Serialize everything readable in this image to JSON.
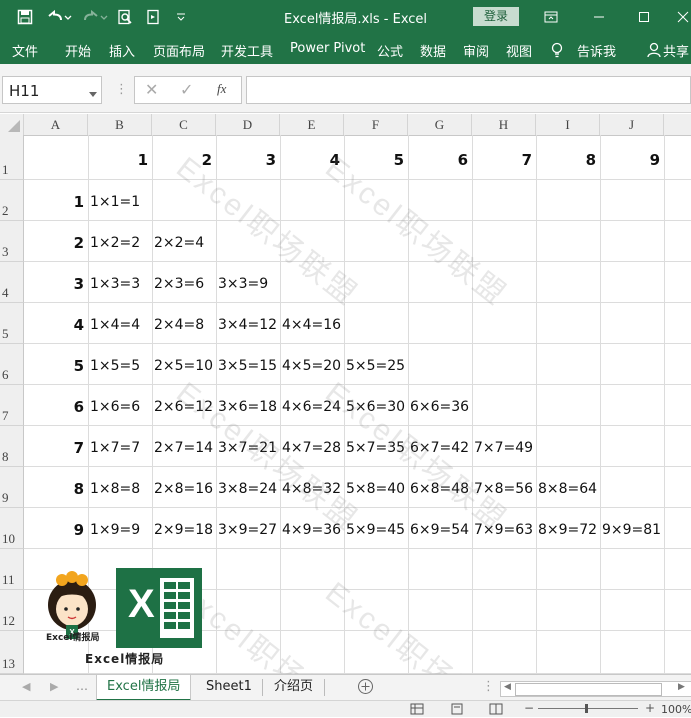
{
  "titlebar": {
    "doc_title": "Excel情报局.xls  -  Excel",
    "login_label": "登录"
  },
  "ribbon": {
    "tabs": [
      "文件",
      "开始",
      "插入",
      "页面布局",
      "开发工具",
      "Power Pivot",
      "公式",
      "数据",
      "审阅",
      "视图"
    ],
    "tell_me": "告诉我",
    "share": "共享"
  },
  "formula_bar": {
    "name_box": "H11",
    "cancel": "✕",
    "confirm": "✓",
    "fx": "fx",
    "value": ""
  },
  "columns": [
    "A",
    "B",
    "C",
    "D",
    "E",
    "F",
    "G",
    "H",
    "I",
    "J"
  ],
  "rows": [
    "1",
    "2",
    "3",
    "4",
    "5",
    "6",
    "7",
    "8",
    "9",
    "10",
    "11",
    "12",
    "13"
  ],
  "table": {
    "top_header": [
      "1",
      "2",
      "3",
      "4",
      "5",
      "6",
      "7",
      "8",
      "9"
    ],
    "left_header": [
      "1",
      "2",
      "3",
      "4",
      "5",
      "6",
      "7",
      "8",
      "9"
    ],
    "cells": [
      [
        "1×1=1"
      ],
      [
        "1×2=2",
        "2×2=4"
      ],
      [
        "1×3=3",
        "2×3=6",
        "3×3=9"
      ],
      [
        "1×4=4",
        "2×4=8",
        "3×4=12",
        "4×4=16"
      ],
      [
        "1×5=5",
        "2×5=10",
        "3×5=15",
        "4×5=20",
        "5×5=25"
      ],
      [
        "1×6=6",
        "2×6=12",
        "3×6=18",
        "4×6=24",
        "5×6=30",
        "6×6=36"
      ],
      [
        "1×7=7",
        "2×7=14",
        "3×7=21",
        "4×7=28",
        "5×7=35",
        "6×7=42",
        "7×7=49"
      ],
      [
        "1×8=8",
        "2×8=16",
        "3×8=24",
        "4×8=32",
        "5×8=40",
        "6×8=48",
        "7×8=56",
        "8×8=64"
      ],
      [
        "1×9=9",
        "2×9=18",
        "3×9=27",
        "4×9=36",
        "5×9=45",
        "6×9=54",
        "7×9=63",
        "8×9=72",
        "9×9=81"
      ]
    ]
  },
  "watermark": "Excel职场联盟",
  "logo": {
    "caption": "Excel情报局",
    "badge": "Excel情报局",
    "excel_letter": "X"
  },
  "sheets": [
    "Excel情报局",
    "Sheet1",
    "介绍页"
  ],
  "status": {
    "zoom": "100%"
  },
  "colors": {
    "accent": "#217346",
    "excel_green": "#1e7145"
  }
}
